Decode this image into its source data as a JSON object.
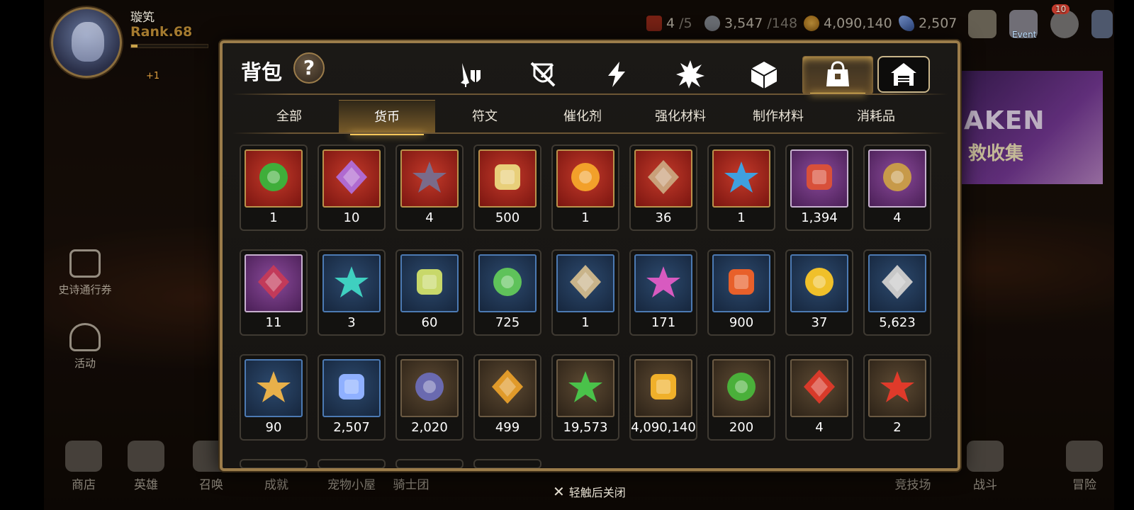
{
  "player": {
    "name": "璇笂",
    "rank": "Rank.68",
    "level_badge": "+1",
    "rank_bar_fraction": 0.08
  },
  "resources": {
    "stamina": {
      "icon": "stamina-icon",
      "value": "4",
      "max": "/5"
    },
    "silver": {
      "icon": "silver-coin-icon",
      "value": "3,547",
      "max": "/148"
    },
    "gold": {
      "icon": "gold-coin-icon",
      "value": "4,090,140"
    },
    "gem": {
      "icon": "gem-icon",
      "value": "2,507"
    }
  },
  "top_icons": {
    "event_label": "Event",
    "chat_badge": "10"
  },
  "side_menu": [
    {
      "label": "史诗通行券",
      "icon": "pass-icon"
    },
    {
      "label": "活动",
      "icon": "bell-icon"
    }
  ],
  "bottom_menu_left": [
    {
      "label": "商店",
      "icon": "scale-icon"
    },
    {
      "label": "英雄",
      "icon": "helmet-icon"
    },
    {
      "label": "召唤",
      "icon": "summon-icon"
    },
    {
      "label": "成就",
      "icon": "trophy-icon"
    },
    {
      "label": "宠物小屋",
      "icon": "pet-house-icon"
    },
    {
      "label": "骑士团",
      "icon": "knights-icon"
    }
  ],
  "bottom_menu_right": [
    {
      "label": "竞技场",
      "icon": "arena-icon"
    },
    {
      "label": "战斗",
      "icon": "swords-icon"
    },
    {
      "label": "冒险",
      "icon": "adventure-icon"
    }
  ],
  "banner": {
    "title": "AKEN",
    "subtitle": "救收集"
  },
  "dialog": {
    "title": "背包",
    "help_label": "?",
    "category_tabs": [
      {
        "name": "weapon-armor-tab",
        "icon": "sword-shield-icon"
      },
      {
        "name": "disabled-equip-tab",
        "icon": "crossed-shield-icon"
      },
      {
        "name": "lightning-tab",
        "icon": "lightning-icon"
      },
      {
        "name": "explosion-tab",
        "icon": "burst-icon"
      },
      {
        "name": "cube-tab",
        "icon": "cube-icon"
      },
      {
        "name": "bag-tab",
        "icon": "bag-icon",
        "active": true
      },
      {
        "name": "house-tab",
        "icon": "house-icon"
      }
    ],
    "sub_tabs": [
      "全部",
      "货币",
      "符文",
      "催化剂",
      "强化材料",
      "制作材料",
      "消耗品"
    ],
    "active_sub_tab": "货币",
    "items": [
      {
        "icon": "clover-pendant-icon",
        "rarity": "red",
        "color": "#3fae3a",
        "count": "1"
      },
      {
        "icon": "disc-emblem-icon",
        "rarity": "red",
        "color": "#b06ad0",
        "count": "10"
      },
      {
        "icon": "dark-ring-icon",
        "rarity": "red",
        "color": "#7a6b8a",
        "count": "4"
      },
      {
        "icon": "eye-emblem-icon",
        "rarity": "red",
        "color": "#e8cf7a",
        "count": "500"
      },
      {
        "icon": "flame-crystal-icon",
        "rarity": "red",
        "color": "#f2a02a",
        "count": "1"
      },
      {
        "icon": "beast-skull-icon",
        "rarity": "red",
        "color": "#c9a07a",
        "count": "36"
      },
      {
        "icon": "blue-drop-pendant-icon",
        "rarity": "red",
        "color": "#3fa0e0",
        "count": "1"
      },
      {
        "icon": "crescent-horn-icon",
        "rarity": "purple",
        "color": "#d8503a",
        "count": "1,394"
      },
      {
        "icon": "treasure-map-icon",
        "rarity": "purple",
        "color": "#c79a4a",
        "count": "4"
      },
      {
        "icon": "gift-box-icon",
        "rarity": "purple",
        "color": "#c23a5a",
        "count": "11"
      },
      {
        "icon": "teal-crystal-icon",
        "rarity": "blue",
        "color": "#3fd0c0",
        "count": "3"
      },
      {
        "icon": "hero-card-icon",
        "rarity": "blue",
        "color": "#c8d86a",
        "count": "60"
      },
      {
        "icon": "green-leaf-icon",
        "rarity": "blue",
        "color": "#5fc25a",
        "count": "725"
      },
      {
        "icon": "sword-pendant-icon",
        "rarity": "blue",
        "color": "#c9b48a",
        "count": "1"
      },
      {
        "icon": "pink-crystal-pile-icon",
        "rarity": "blue",
        "color": "#d85ac0",
        "count": "171"
      },
      {
        "icon": "fire-orb-icon",
        "rarity": "blue",
        "color": "#e8602a",
        "count": "900"
      },
      {
        "icon": "persimmon-icon",
        "rarity": "blue",
        "color": "#f0c02a",
        "count": "37"
      },
      {
        "icon": "silver-coin-icon",
        "rarity": "blue",
        "color": "#c8c8c8",
        "count": "5,623"
      },
      {
        "icon": "star-pendant-icon",
        "rarity": "blue",
        "color": "#e8b04a",
        "count": "90"
      },
      {
        "icon": "blue-diamond-icon",
        "rarity": "blue",
        "color": "#8fb0ff",
        "count": "2,507"
      },
      {
        "icon": "fist-medal-icon",
        "rarity": "gold",
        "color": "#6a6ab0",
        "count": "2,020"
      },
      {
        "icon": "gold-badge-icon",
        "rarity": "gold",
        "color": "#e09a2a",
        "count": "499"
      },
      {
        "icon": "green-heart-icon",
        "rarity": "gold",
        "color": "#4ac24a",
        "count": "19,573"
      },
      {
        "icon": "gold-coin-icon",
        "rarity": "gold",
        "color": "#f0b02a",
        "count": "4,090,140"
      },
      {
        "icon": "clover-icon",
        "rarity": "gold",
        "color": "#4ab03a",
        "count": "200"
      },
      {
        "icon": "red-banner-icon",
        "rarity": "gold",
        "color": "#d83a2a",
        "count": "4"
      },
      {
        "icon": "bottle-cap-icon",
        "rarity": "gold",
        "color": "#e03a2a",
        "count": "2"
      }
    ],
    "partial_row_count": 4
  },
  "close_hint": {
    "icon": "close-icon",
    "label": "轻触后关闭"
  }
}
